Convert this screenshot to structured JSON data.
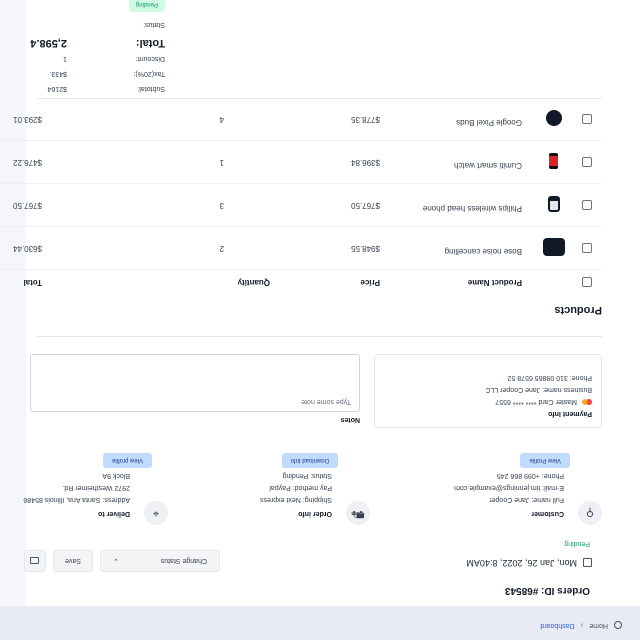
{
  "breadcrumb": {
    "home": "Home",
    "dashboard": "Dashboard"
  },
  "order": {
    "id_label": "Orders ID: #68543",
    "date": "Mon, Jan 26, 2022, 8:40AM",
    "status": "Pending"
  },
  "actions": {
    "status_select": "Change Status",
    "save": "Save"
  },
  "customer": {
    "heading": "Customer",
    "full_name": "Full name: Jane Cooper",
    "email": "E-mail: tim.jennings@example.com",
    "phone": "Phone: +099 866 245",
    "button": "View Profile"
  },
  "order_info": {
    "heading": "Order info",
    "shipping": "Shipping: Next express",
    "pay_method": "Pay method: Paypal",
    "status": "Status: Pending",
    "button": "Download Info"
  },
  "deliver_to": {
    "heading": "Deliver to",
    "address": "Address: Santa Ana, Illinois 85486",
    "line2": "2972 Westheimer Rd.",
    "line3": "Block 9A",
    "button": "View profile"
  },
  "payment": {
    "heading": "Payment Info",
    "card": "Master Card **** **** 6557",
    "business": "Business name: Jane Cooper LLC",
    "phone": "Phone: 310 09865 6578 52"
  },
  "notes": {
    "label": "Notes",
    "placeholder": "Type some note"
  },
  "products": {
    "title": "Products",
    "headers": {
      "name": "Product Name",
      "price": "Price",
      "quantity": "Quantity",
      "total": "Total"
    },
    "rows": [
      {
        "name": "Google Pixel Buds",
        "price": "$778.35",
        "quantity": "4",
        "total": "$293.01",
        "thumb": "earbuds-icon"
      },
      {
        "name": "Cumiti smart watch",
        "price": "$396.84",
        "quantity": "1",
        "total": "$476.22",
        "thumb": "smartwatch-icon"
      },
      {
        "name": "Philips wireless head phone",
        "price": "$767.50",
        "quantity": "3",
        "total": "$767.50",
        "thumb": "headphone-icon"
      },
      {
        "name": "Bose noise cancelling",
        "price": "$948.55",
        "quantity": "2",
        "total": "$630.44",
        "thumb": "bose-headphone-icon"
      }
    ]
  },
  "summary": {
    "subtotal_label": "Subtotal:",
    "subtotal_value": "$2164",
    "tax_label": "Tax(20%):",
    "tax_value": "$433.",
    "discount_label": "Discount:",
    "discount_value": "1",
    "total_label": "Total:",
    "total_value": "2,598.4",
    "status_label": "Status:",
    "status_value": "Pending"
  },
  "colors": {
    "accent": "#2563eb",
    "pending": "#059669",
    "topbar": "#e8ebf3"
  }
}
